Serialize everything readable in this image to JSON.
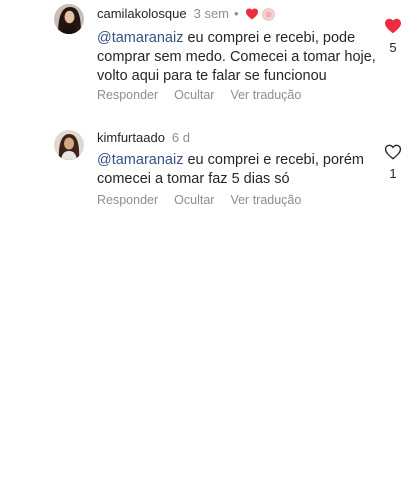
{
  "comments": [
    {
      "username": "camilakolosque",
      "time": "3 sem",
      "mention": "@tamaranaiz",
      "text": " eu comprei e recebi, pode comprar sem medo. Comecei a tomar hoje, volto aqui para te falar se funcionou",
      "actions": {
        "reply": "Responder",
        "hide": "Ocultar",
        "translate": "Ver tradução"
      },
      "like_count": "5",
      "liked": true
    },
    {
      "username": "kimfurtaado",
      "time": "6 d",
      "mention": "@tamaranaiz",
      "text": " eu comprei e recebi, porém comecei a tomar faz 5 dias só",
      "actions": {
        "reply": "Responder",
        "hide": "Ocultar",
        "translate": "Ver tradução"
      },
      "like_count": "1",
      "liked": false
    }
  ],
  "icons": {
    "like_filled": "heart-filled-icon",
    "like_outline": "heart-outline-icon",
    "creator_badge": "creator-heart-badge"
  },
  "colors": {
    "heart_red": "#ed2d3d",
    "mention_blue": "#385185",
    "muted_text": "#8e8e8e",
    "primary_text": "#262626"
  }
}
